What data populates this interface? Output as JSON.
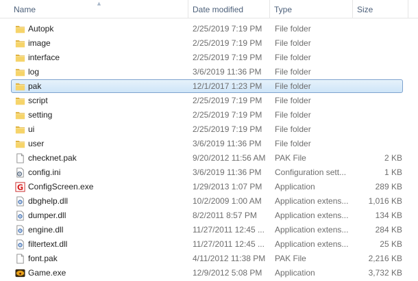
{
  "columns": {
    "name": "Name",
    "date": "Date modified",
    "type": "Type",
    "size": "Size"
  },
  "selected_index": 4,
  "files": [
    {
      "name": "Autopk",
      "date": "2/25/2019 7:19 PM",
      "type": "File folder",
      "size": "",
      "icon": "folder-icon"
    },
    {
      "name": "image",
      "date": "2/25/2019 7:19 PM",
      "type": "File folder",
      "size": "",
      "icon": "folder-icon"
    },
    {
      "name": "interface",
      "date": "2/25/2019 7:19 PM",
      "type": "File folder",
      "size": "",
      "icon": "folder-icon"
    },
    {
      "name": "log",
      "date": "3/6/2019 11:36 PM",
      "type": "File folder",
      "size": "",
      "icon": "folder-icon"
    },
    {
      "name": "pak",
      "date": "12/1/2017 1:23 PM",
      "type": "File folder",
      "size": "",
      "icon": "folder-icon"
    },
    {
      "name": "script",
      "date": "2/25/2019 7:19 PM",
      "type": "File folder",
      "size": "",
      "icon": "folder-icon"
    },
    {
      "name": "setting",
      "date": "2/25/2019 7:19 PM",
      "type": "File folder",
      "size": "",
      "icon": "folder-icon"
    },
    {
      "name": "ui",
      "date": "2/25/2019 7:19 PM",
      "type": "File folder",
      "size": "",
      "icon": "folder-icon"
    },
    {
      "name": "user",
      "date": "3/6/2019 11:36 PM",
      "type": "File folder",
      "size": "",
      "icon": "folder-icon"
    },
    {
      "name": "checknet.pak",
      "date": "9/20/2012 11:56 AM",
      "type": "PAK File",
      "size": "2 KB",
      "icon": "file-icon"
    },
    {
      "name": "config.ini",
      "date": "3/6/2019 11:36 PM",
      "type": "Configuration sett...",
      "size": "1 KB",
      "icon": "config-file-icon"
    },
    {
      "name": "ConfigScreen.exe",
      "date": "1/29/2013 1:07 PM",
      "type": "Application",
      "size": "289 KB",
      "icon": "config-screen-app-icon"
    },
    {
      "name": "dbghelp.dll",
      "date": "10/2/2009 1:00 AM",
      "type": "Application extens...",
      "size": "1,016 KB",
      "icon": "dll-icon"
    },
    {
      "name": "dumper.dll",
      "date": "8/2/2011 8:57 PM",
      "type": "Application extens...",
      "size": "134 KB",
      "icon": "dll-icon"
    },
    {
      "name": "engine.dll",
      "date": "11/27/2011 12:45 ...",
      "type": "Application extens...",
      "size": "284 KB",
      "icon": "dll-icon"
    },
    {
      "name": "filtertext.dll",
      "date": "11/27/2011 12:45 ...",
      "type": "Application extens...",
      "size": "25 KB",
      "icon": "dll-icon"
    },
    {
      "name": "font.pak",
      "date": "4/11/2012 11:38 PM",
      "type": "PAK File",
      "size": "2,216 KB",
      "icon": "file-icon"
    },
    {
      "name": "Game.exe",
      "date": "12/9/2012 5:08 PM",
      "type": "Application",
      "size": "3,732 KB",
      "icon": "game-app-icon"
    }
  ]
}
